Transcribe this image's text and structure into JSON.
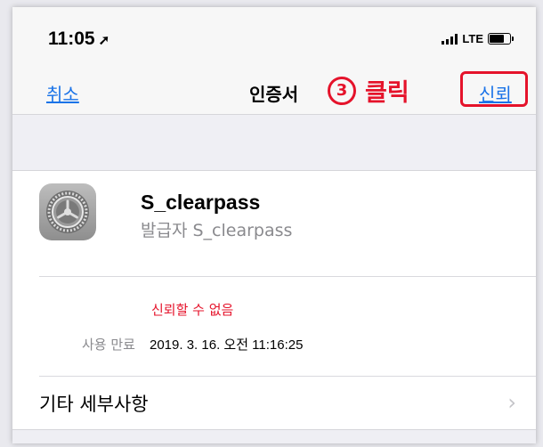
{
  "status_bar": {
    "time": "11:05",
    "location_icon": "location-arrow-icon",
    "network": "LTE"
  },
  "nav": {
    "cancel_label": "취소",
    "title": "인증서",
    "trust_label": "신뢰"
  },
  "annotation": {
    "number": "3",
    "text": "클릭",
    "color": "#e5132b"
  },
  "certificate": {
    "icon": "settings-gear-icon",
    "name": "S_clearpass",
    "issuer": "발급자 S_clearpass",
    "status": "신뢰할 수 없음",
    "expires_label": "사용 만료",
    "expires_value": "2019. 3. 16. 오전 11:16:25"
  },
  "more_details": {
    "label": "기타 세부사항"
  },
  "colors": {
    "accent": "#1a73e8",
    "warning": "#e5132b"
  }
}
